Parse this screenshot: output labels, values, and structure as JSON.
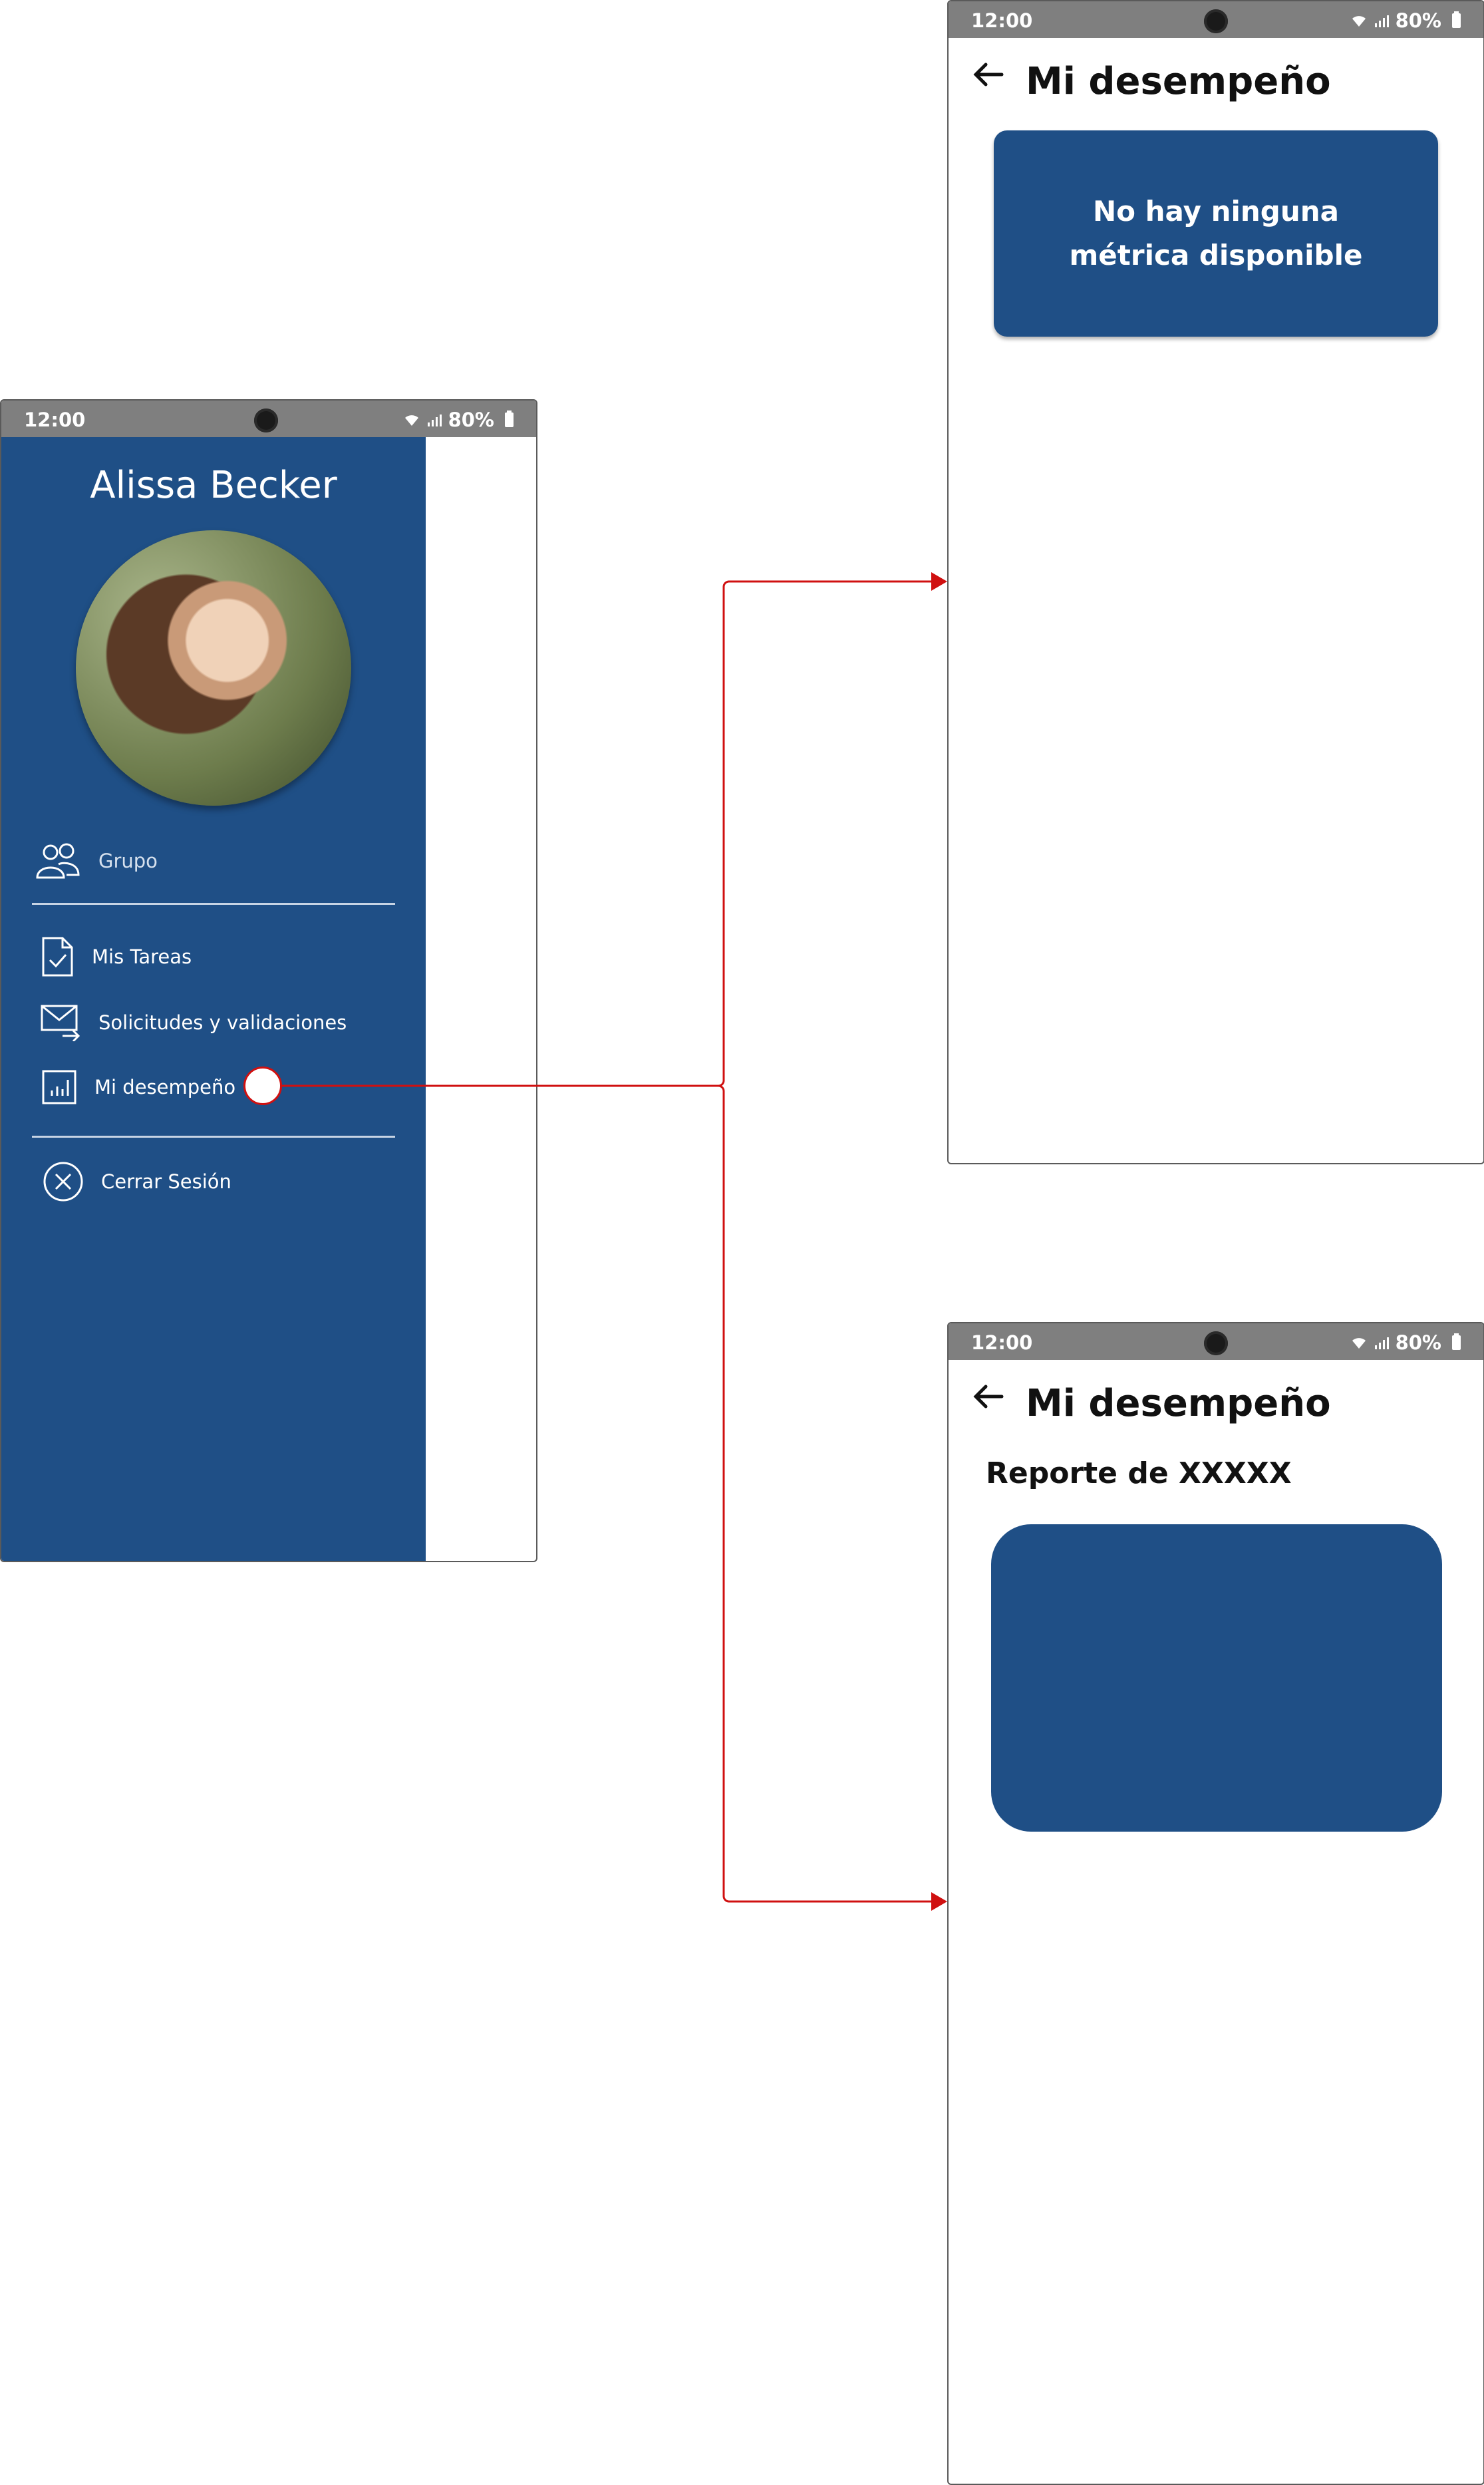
{
  "status_bar": {
    "time": "12:00",
    "battery": "80%"
  },
  "drawer": {
    "user_name": "Alissa Becker",
    "avatar_alt": "profile-photo",
    "items": [
      {
        "label": "Grupo",
        "icon": "group-icon"
      },
      {
        "label": "Mis Tareas",
        "icon": "task-document-icon"
      },
      {
        "label": "Solicitudes y validaciones",
        "icon": "mail-forward-icon"
      },
      {
        "label": "Mi desempeño",
        "icon": "bar-chart-icon"
      },
      {
        "label": "Cerrar Sesión",
        "icon": "close-circle-icon"
      }
    ]
  },
  "screen_empty": {
    "title": "Mi desempeño",
    "message": "No hay ninguna métrica disponible"
  },
  "screen_report": {
    "title": "Mi desempeño",
    "report_label": "Reporte de XXXXX"
  },
  "colors": {
    "primary": "#1f4f86",
    "status_bar": "#7f7f7f",
    "connector": "#d01010"
  }
}
